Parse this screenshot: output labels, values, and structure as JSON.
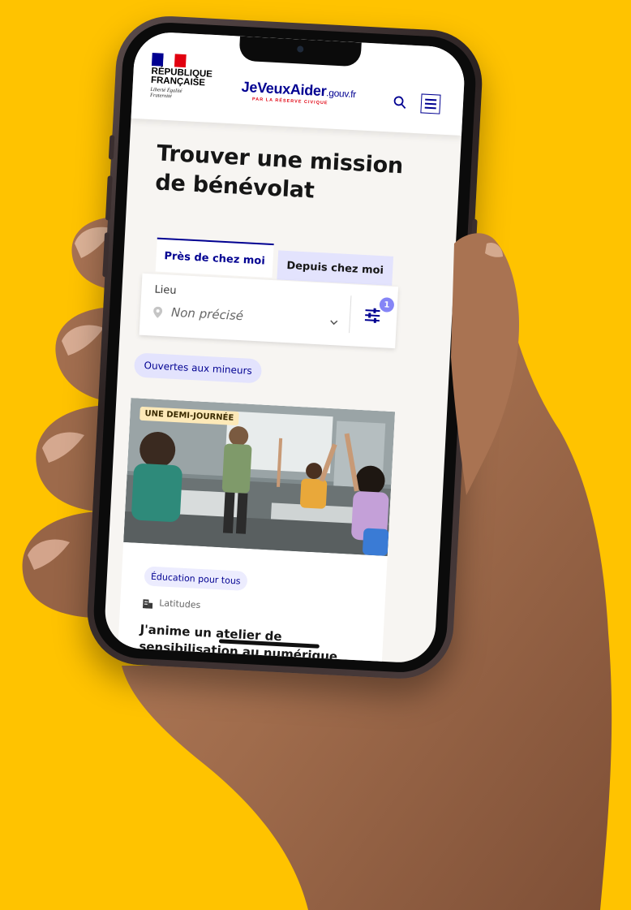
{
  "colors": {
    "background": "#FFC300",
    "brand_blue": "#000091",
    "brand_red": "#E1000F",
    "tab_inactive": "#E3E3FD",
    "badge": "#8585F6",
    "duration_tag": "#FDE9B8"
  },
  "header": {
    "gov_block": {
      "title": "RÉPUBLIQUE FRANÇAISE",
      "motto": "Liberté Égalité Fraternité"
    },
    "brand": {
      "name": "JeVeuxAider",
      "suffix": ".gouv.fr",
      "tagline": "PAR LA RÉSERVE CIVIQUE"
    },
    "icons": [
      "search-icon",
      "menu-icon"
    ]
  },
  "page": {
    "title": "Trouver une mission de bénévolat"
  },
  "tabs": [
    {
      "label": "Près de chez moi",
      "active": true
    },
    {
      "label": "Depuis chez moi",
      "active": false
    }
  ],
  "location_filter": {
    "label": "Lieu",
    "value": "Non précisé",
    "filters_count": "1"
  },
  "quick_filter": {
    "label": "Ouvertes aux mineurs"
  },
  "mission_card": {
    "duration": "UNE DEMI-JOURNÉE",
    "category": "Éducation pour tous",
    "organization": "Latitudes",
    "title": "J'anime un atelier de sensibilisation au numérique pour les ados"
  }
}
